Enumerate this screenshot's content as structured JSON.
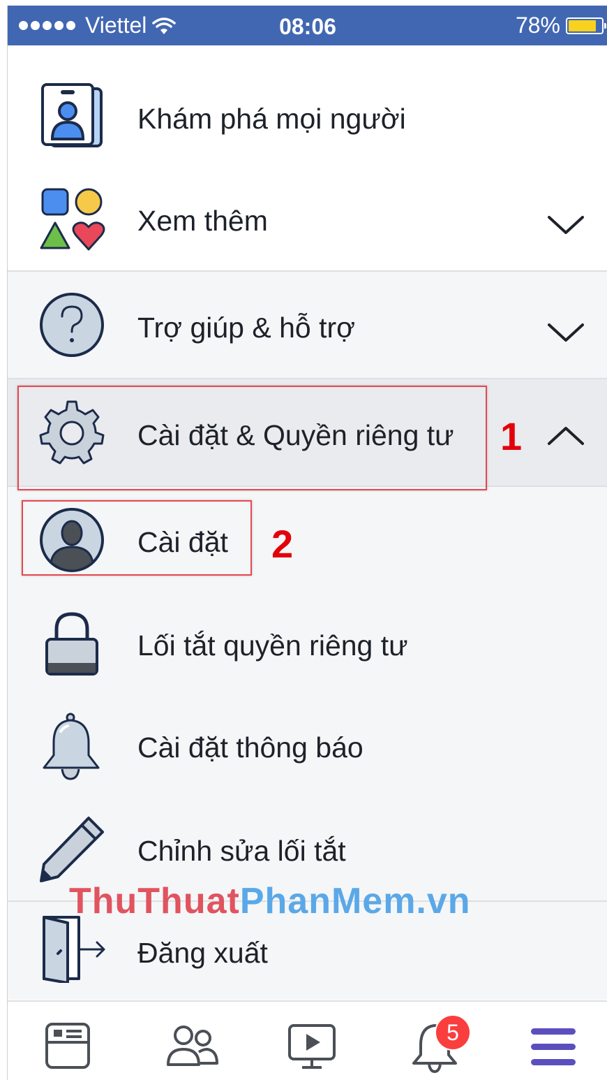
{
  "status_bar": {
    "carrier": "Viettel",
    "time": "08:06",
    "battery": "78%",
    "battery_level": 0.78
  },
  "menu": {
    "discover_people": "Khám phá mọi người",
    "see_more": "Xem thêm",
    "help_support": "Trợ giúp & hỗ trợ",
    "settings_privacy": "Cài đặt & Quyền riêng tư",
    "settings": "Cài đặt",
    "privacy_shortcuts": "Lối tắt quyền riêng tư",
    "notification_settings": "Cài đặt thông báo",
    "edit_shortcuts": "Chỉnh sửa lối tắt",
    "logout": "Đăng xuất"
  },
  "annotations": {
    "step1": "1",
    "step2": "2"
  },
  "watermark": {
    "part1": "ThuThuat",
    "part2": "PhanMem.vn"
  },
  "tabbar": {
    "notifications_badge": "5",
    "icons": [
      "news-feed-icon",
      "friends-icon",
      "watch-icon",
      "notifications-icon",
      "menu-icon"
    ]
  },
  "colors": {
    "status_bar": "#4267b2",
    "annotation_red": "#e3000b",
    "menu_active": "#5b4fbf"
  }
}
